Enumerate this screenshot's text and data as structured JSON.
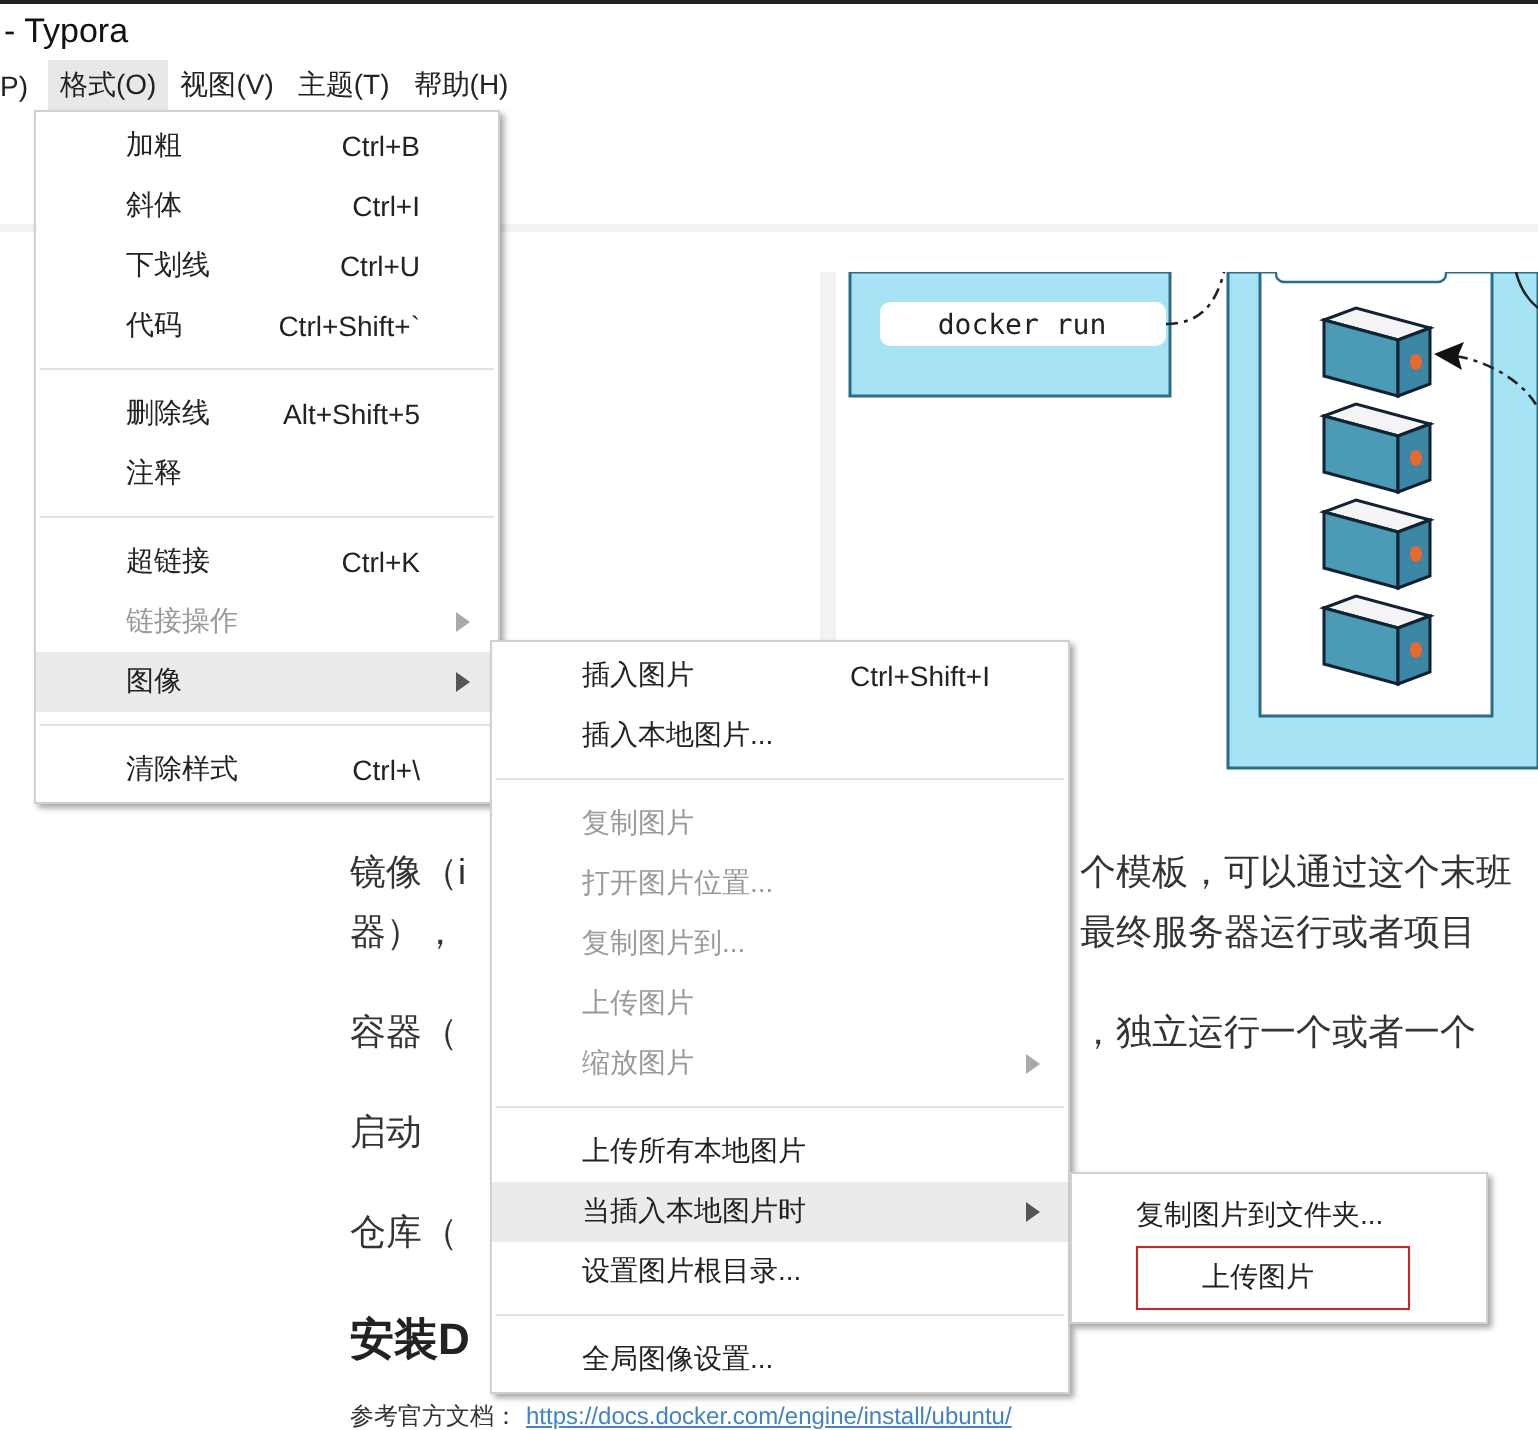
{
  "window": {
    "title": "- Typora"
  },
  "menubar": [
    {
      "label": "P)",
      "selected": false
    },
    {
      "label": "格式(O)",
      "selected": true
    },
    {
      "label": "视图(V)",
      "selected": false
    },
    {
      "label": "主题(T)",
      "selected": false
    },
    {
      "label": "帮助(H)",
      "selected": false
    }
  ],
  "format_menu": [
    {
      "kind": "item",
      "label": "加粗",
      "shortcut": "Ctrl+B",
      "disabled": false,
      "selected": false,
      "submenu": false
    },
    {
      "kind": "item",
      "label": "斜体",
      "shortcut": "Ctrl+I",
      "disabled": false,
      "selected": false,
      "submenu": false
    },
    {
      "kind": "item",
      "label": "下划线",
      "shortcut": "Ctrl+U",
      "disabled": false,
      "selected": false,
      "submenu": false
    },
    {
      "kind": "item",
      "label": "代码",
      "shortcut": "Ctrl+Shift+`",
      "disabled": false,
      "selected": false,
      "submenu": false
    },
    {
      "kind": "separator"
    },
    {
      "kind": "item",
      "label": "删除线",
      "shortcut": "Alt+Shift+5",
      "disabled": false,
      "selected": false,
      "submenu": false
    },
    {
      "kind": "item",
      "label": "注释",
      "disabled": false,
      "selected": false,
      "submenu": false
    },
    {
      "kind": "separator"
    },
    {
      "kind": "item",
      "label": "超链接",
      "shortcut": "Ctrl+K",
      "disabled": false,
      "selected": false,
      "submenu": false
    },
    {
      "kind": "item",
      "label": "链接操作",
      "disabled": true,
      "selected": false,
      "submenu": true
    },
    {
      "kind": "item",
      "label": "图像",
      "disabled": false,
      "selected": true,
      "submenu": true
    },
    {
      "kind": "separator"
    },
    {
      "kind": "item",
      "label": "清除样式",
      "shortcut": "Ctrl+\\",
      "disabled": false,
      "selected": false,
      "submenu": false
    }
  ],
  "image_submenu": [
    {
      "kind": "item",
      "label": "插入图片",
      "shortcut": "Ctrl+Shift+I",
      "disabled": false,
      "selected": false,
      "submenu": false
    },
    {
      "kind": "item",
      "label": "插入本地图片...",
      "disabled": false,
      "selected": false,
      "submenu": false
    },
    {
      "kind": "separator"
    },
    {
      "kind": "item",
      "label": "复制图片",
      "disabled": true,
      "selected": false,
      "submenu": false
    },
    {
      "kind": "item",
      "label": "打开图片位置...",
      "disabled": true,
      "selected": false,
      "submenu": false
    },
    {
      "kind": "item",
      "label": "复制图片到...",
      "disabled": true,
      "selected": false,
      "submenu": false
    },
    {
      "kind": "item",
      "label": "上传图片",
      "disabled": true,
      "selected": false,
      "submenu": false
    },
    {
      "kind": "item",
      "label": "缩放图片",
      "disabled": true,
      "selected": false,
      "submenu": true
    },
    {
      "kind": "separator"
    },
    {
      "kind": "item",
      "label": "上传所有本地图片",
      "disabled": false,
      "selected": false,
      "submenu": false
    },
    {
      "kind": "item",
      "label": "当插入本地图片时",
      "disabled": false,
      "selected": true,
      "submenu": true
    },
    {
      "kind": "item",
      "label": "设置图片根目录...",
      "disabled": false,
      "selected": false,
      "submenu": false
    },
    {
      "kind": "separator"
    },
    {
      "kind": "item",
      "label": "全局图像设置...",
      "disabled": false,
      "selected": false,
      "submenu": false
    }
  ],
  "insert_submenu": [
    {
      "kind": "item",
      "label": "复制图片到文件夹...",
      "outlined": false
    },
    {
      "kind": "item",
      "label": "上传图片",
      "outlined": true
    }
  ],
  "document": {
    "figure": {
      "label": "docker run"
    },
    "blocks": [
      {
        "kind": "text",
        "lines": [
          {
            "left": "镜像（i",
            "right": "个模板，可以通过这个末班"
          },
          {
            "left": "器），",
            "right": "最终服务器运行或者项目"
          }
        ]
      },
      {
        "kind": "text",
        "lines": [
          {
            "left": "容器（",
            "right": "，独立运行一个或者一个"
          }
        ]
      },
      {
        "kind": "text",
        "lines": [
          {
            "left": "启动"
          }
        ]
      },
      {
        "kind": "text",
        "lines": [
          {
            "left": "仓库（"
          }
        ]
      },
      {
        "kind": "heading",
        "left": "安装D"
      },
      {
        "kind": "link",
        "left": "参考官方文档：",
        "link": "https://docs.docker.com/engine/install/ubuntu/"
      }
    ]
  }
}
